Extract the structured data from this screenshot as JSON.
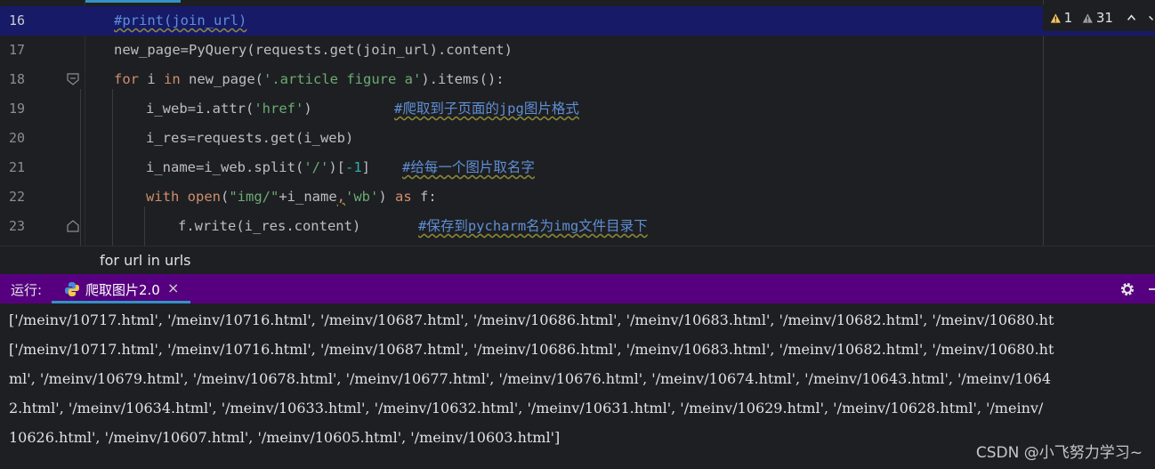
{
  "editor": {
    "lines": [
      {
        "num": "16",
        "code": "#print(join_url)"
      },
      {
        "num": "17",
        "code": "new_page=PyQuery(requests.get(join_url).content)"
      },
      {
        "num": "18",
        "code_parts": [
          "for",
          " i ",
          "in",
          " new_page(",
          "'.article figure a'",
          ").items():"
        ]
      },
      {
        "num": "19",
        "code_parts": [
          "i_web=i.attr(",
          "'href'",
          ")",
          "#爬取到子页面的jpg图片格式"
        ]
      },
      {
        "num": "20",
        "code": "i_res=requests.get(i_web)"
      },
      {
        "num": "21",
        "code_parts": [
          "i_name=i_web.split(",
          "'/'",
          ")[",
          "-1",
          "]",
          "#给每一个图片取名字"
        ]
      },
      {
        "num": "22",
        "code_parts": [
          "with",
          " ",
          "open",
          "(",
          "\"img/\"",
          "+i_name",
          ",",
          "'wb'",
          ") ",
          "as",
          " f:"
        ]
      },
      {
        "num": "23",
        "code_parts": [
          "f.write(i_res.content)",
          "#保存到pycharm名为img文件目录下"
        ]
      }
    ],
    "inspections": {
      "warnings": "1",
      "weak_warnings": "31"
    }
  },
  "breadcrumb": "for url in urls",
  "run_panel": {
    "label": "运行:",
    "tab_name": "爬取图片2.0",
    "close": "×"
  },
  "console": {
    "lines": [
      "['/meinv/10717.html', '/meinv/10716.html', '/meinv/10687.html', '/meinv/10686.html', '/meinv/10683.html', '/meinv/10682.html', '/meinv/10680.ht",
      "['/meinv/10717.html', '/meinv/10716.html', '/meinv/10687.html', '/meinv/10686.html', '/meinv/10683.html', '/meinv/10682.html', '/meinv/10680.ht",
      "ml', '/meinv/10679.html', '/meinv/10678.html', '/meinv/10677.html', '/meinv/10676.html', '/meinv/10674.html', '/meinv/10643.html', '/meinv/1064",
      "2.html', '/meinv/10634.html', '/meinv/10633.html', '/meinv/10632.html', '/meinv/10631.html', '/meinv/10629.html', '/meinv/10628.html', '/meinv/",
      "10626.html', '/meinv/10607.html', '/meinv/10605.html', '/meinv/10603.html']"
    ]
  },
  "watermark": "CSDN @小飞努力学习~"
}
